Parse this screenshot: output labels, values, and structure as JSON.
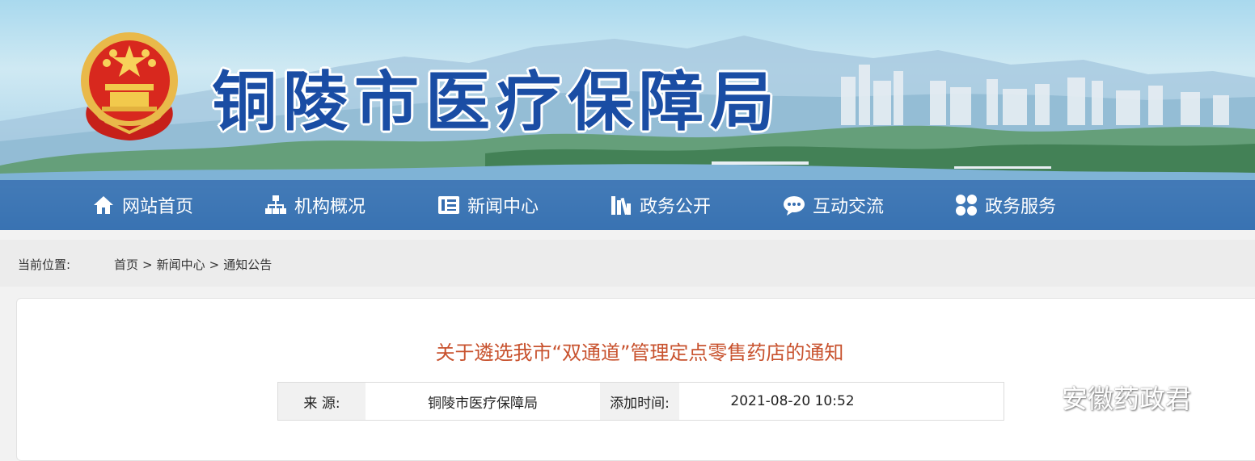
{
  "site": {
    "title": "铜陵市医疗保障局"
  },
  "nav": {
    "items": [
      {
        "label": "网站首页",
        "icon": "home-icon"
      },
      {
        "label": "机构概况",
        "icon": "org-chart-icon"
      },
      {
        "label": "新闻中心",
        "icon": "news-icon"
      },
      {
        "label": "政务公开",
        "icon": "books-icon"
      },
      {
        "label": "互动交流",
        "icon": "chat-icon"
      },
      {
        "label": "政务服务",
        "icon": "grid-icon"
      }
    ]
  },
  "breadcrumb": {
    "label": "当前位置:",
    "items": [
      "首页",
      "新闻中心",
      "通知公告"
    ],
    "separator": ">"
  },
  "article": {
    "title": "关于遴选我市“双通道”管理定点零售药店的通知",
    "source_label": "来 源:",
    "source_value": "铜陵市医疗保障局",
    "time_label": "添加时间:",
    "time_value": "2021-08-20 10:52"
  },
  "watermark": {
    "text": "安徽药政君",
    "icon": "wechat-icon"
  },
  "colors": {
    "nav_bg": "#346cb0",
    "title_blue": "#1a4da4",
    "article_title": "#c8522e"
  }
}
